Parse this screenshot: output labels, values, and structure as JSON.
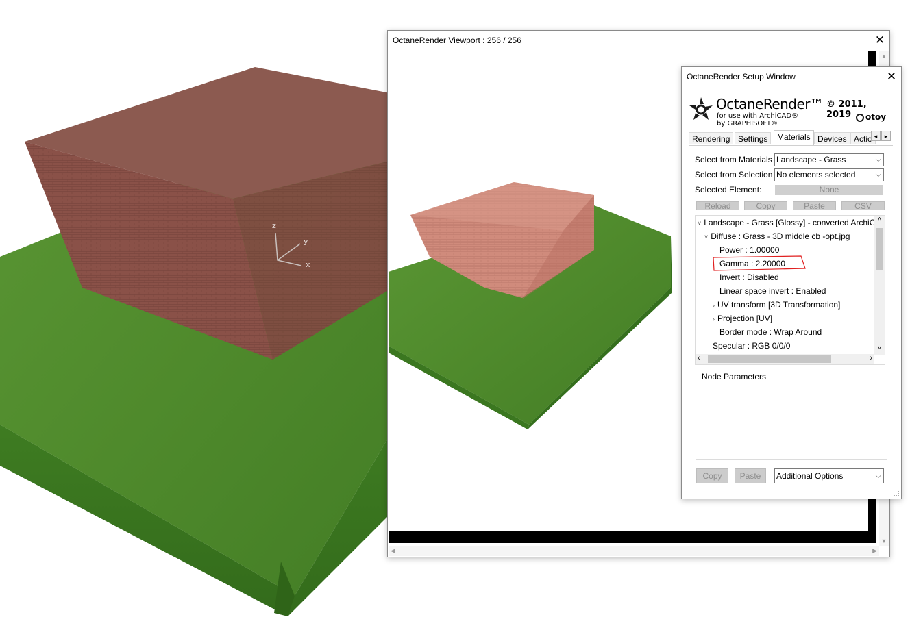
{
  "viewport": {
    "title": "OctaneRender Viewport : 256  / 256",
    "close_label": "✕"
  },
  "axes": {
    "z": "z",
    "y": "y",
    "x": "x"
  },
  "setup": {
    "title": "OctaneRender Setup Window",
    "close_label": "✕",
    "logo": {
      "name": "OctaneRender™",
      "line1": "for use with ArchiCAD®",
      "line2": "by GRAPHISOFT®",
      "copyright": "© 2011, 2019",
      "brand": "otoy",
      "icon": "octane-logo-icon"
    },
    "tabs": [
      "Rendering",
      "Settings",
      "Materials",
      "Devices",
      "Actio"
    ],
    "active_tab": "Materials",
    "tab_left": "◂",
    "tab_right": "▸",
    "select_material_label": "Select from Materials",
    "select_material_value": "Landscape - Grass",
    "select_selection_label": "Select from Selection",
    "select_selection_value": "No elements selected",
    "selected_element_label": "Selected Element:",
    "selected_element_value": "None",
    "buttons": {
      "reload": "Reload",
      "copy": "Copy",
      "paste": "Paste",
      "csv": "CSV"
    },
    "tree": [
      {
        "text": "Landscape - Grass  [Glossy] - converted ArchiCAD Material",
        "indent": 0,
        "arrow": "˅"
      },
      {
        "text": "Diffuse : Grass - 3D middle cb -opt.jpg",
        "indent": 1,
        "arrow": "˅"
      },
      {
        "text": "Power : 1.00000",
        "indent": 2,
        "arrow": ""
      },
      {
        "text": "Gamma : 2.20000",
        "indent": 2,
        "arrow": ""
      },
      {
        "text": "Invert : Disabled",
        "indent": 2,
        "arrow": ""
      },
      {
        "text": "Linear space invert : Enabled",
        "indent": 2,
        "arrow": ""
      },
      {
        "text": "UV transform  [3D Transformation]",
        "indent": 2,
        "arrow": "›"
      },
      {
        "text": "Projection  [UV]",
        "indent": 2,
        "arrow": "›"
      },
      {
        "text": "Border mode : Wrap Around",
        "indent": 2,
        "arrow": ""
      },
      {
        "text": "Specular : RGB 0/0/0",
        "indent": 1,
        "arrow": ""
      }
    ],
    "node_params_label": "Node Parameters",
    "bottom": {
      "copy": "Copy",
      "paste": "Paste",
      "options": "Additional Options"
    }
  },
  "colors": {
    "brick": "#8e5249",
    "brick_light": "#cc8677",
    "grass": "#4d8c2c",
    "highlight": "#e02020"
  }
}
